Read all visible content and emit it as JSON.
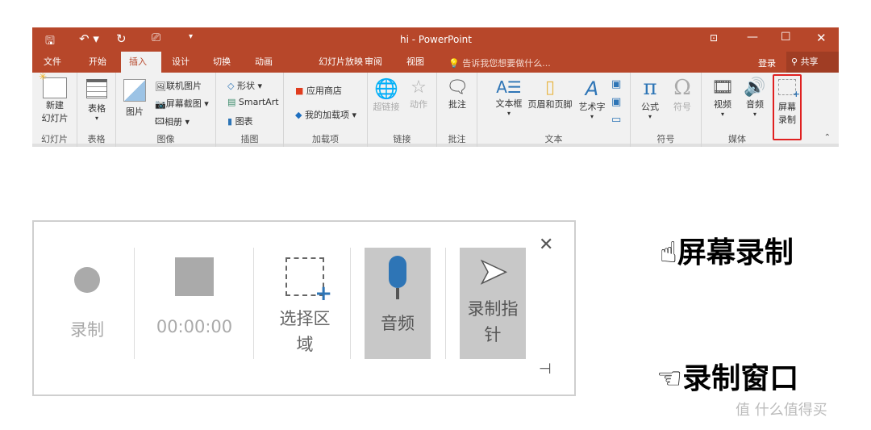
{
  "window": {
    "title": "hi - PowerPoint"
  },
  "tabs": [
    "文件",
    "开始",
    "插入",
    "设计",
    "切换",
    "动画",
    "幻灯片放映",
    "审阅",
    "视图"
  ],
  "active_tab": "插入",
  "tell_me": "告诉我您想要做什么...",
  "signin": "登录",
  "share": "共享",
  "ribbon": {
    "slides": {
      "new_slide": "新建",
      "new_slide2": "幻灯片",
      "label": "幻灯片"
    },
    "tables": {
      "table": "表格",
      "label": "表格"
    },
    "images": {
      "pictures": "图片",
      "online": "联机图片",
      "screenshot": "屏幕截图",
      "album": "相册",
      "label": "图像"
    },
    "illustrations": {
      "shapes": "形状",
      "smartart": "SmartArt",
      "chart": "图表",
      "label": "插图"
    },
    "addins": {
      "store": "应用商店",
      "my_addins": "我的加载项",
      "label": "加载项"
    },
    "links": {
      "hyperlink": "超链接",
      "action": "动作",
      "label": "链接"
    },
    "comments": {
      "comment": "批注",
      "label": "批注"
    },
    "text": {
      "textbox": "文本框",
      "header_footer": "页眉和页脚",
      "wordart": "艺术字",
      "label": "文本"
    },
    "symbols": {
      "equation": "公式",
      "symbol": "符号",
      "label": "符号"
    },
    "media": {
      "video": "视频",
      "audio": "音频",
      "screen_rec1": "屏幕",
      "screen_rec2": "录制",
      "label": "媒体"
    }
  },
  "recorder": {
    "record": "录制",
    "time": "00:00:00",
    "select_area": "选择区域",
    "audio": "音频",
    "pointer": "录制指针"
  },
  "annotations": {
    "a1": "屏幕录制",
    "a2": "录制窗口"
  },
  "watermark": "值 什么值得买",
  "colors": {
    "accent": "#b7472a",
    "highlight": "#e02020"
  }
}
